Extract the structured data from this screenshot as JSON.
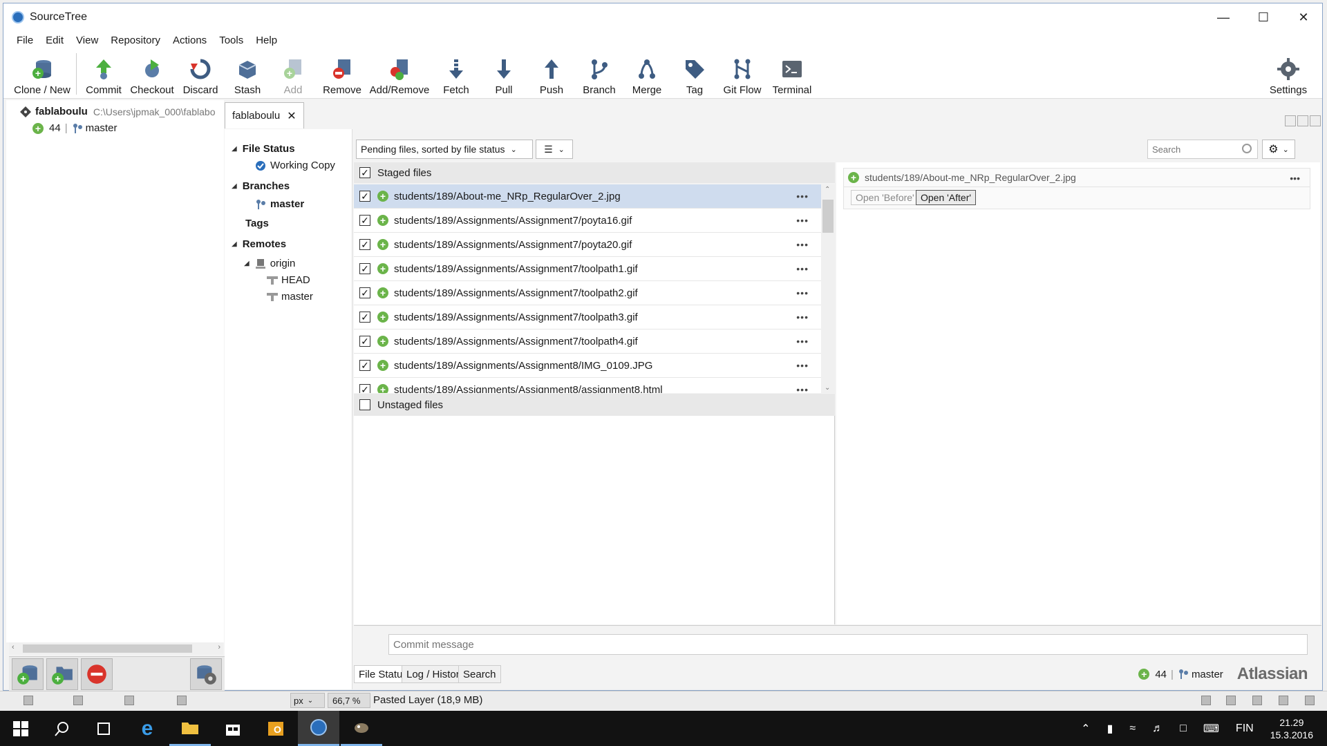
{
  "window": {
    "title": "SourceTree",
    "controls": [
      "minimize",
      "maximize",
      "close"
    ]
  },
  "menu": [
    "File",
    "Edit",
    "View",
    "Repository",
    "Actions",
    "Tools",
    "Help"
  ],
  "toolbar": {
    "clone": "Clone / New",
    "commit": "Commit",
    "checkout": "Checkout",
    "discard": "Discard",
    "stash": "Stash",
    "add": "Add",
    "remove": "Remove",
    "addremove": "Add/Remove",
    "fetch": "Fetch",
    "pull": "Pull",
    "push": "Push",
    "branch": "Branch",
    "merge": "Merge",
    "tag": "Tag",
    "gitflow": "Git Flow",
    "terminal": "Terminal",
    "settings": "Settings"
  },
  "repo": {
    "name": "fablaboulu",
    "path": "C:\\Users\\jpmak_000\\fablabo",
    "count": "44",
    "branch": "master"
  },
  "tab": {
    "label": "fablaboulu"
  },
  "tree": {
    "file_status": "File Status",
    "working_copy": "Working Copy",
    "branches": "Branches",
    "branch_master": "master",
    "tags": "Tags",
    "remotes": "Remotes",
    "origin": "origin",
    "head": "HEAD",
    "remote_master": "master"
  },
  "filter": {
    "sort": "Pending files, sorted by file status",
    "search_placeholder": "Search"
  },
  "staged": {
    "label": "Staged files",
    "files": [
      "students/189/About-me_NRp_RegularOver_2.jpg",
      "students/189/Assignments/Assignment7/poyta16.gif",
      "students/189/Assignments/Assignment7/poyta20.gif",
      "students/189/Assignments/Assignment7/toolpath1.gif",
      "students/189/Assignments/Assignment7/toolpath2.gif",
      "students/189/Assignments/Assignment7/toolpath3.gif",
      "students/189/Assignments/Assignment7/toolpath4.gif",
      "students/189/Assignments/Assignment8/IMG_0109.JPG",
      "students/189/Assignments/Assignment8/assignment8.html"
    ]
  },
  "unstaged": {
    "label": "Unstaged files"
  },
  "preview": {
    "file": "students/189/About-me_NRp_RegularOver_2.jpg",
    "open_before": "Open 'Before'",
    "open_after": "Open 'After'"
  },
  "commit": {
    "placeholder": "Commit message"
  },
  "bottom_tabs": [
    "File Status",
    "Log / History",
    "Search"
  ],
  "status": {
    "count": "44",
    "branch": "master",
    "brand": "Atlassian"
  },
  "gimp": {
    "unit": "px",
    "zoom": "66,7 %",
    "layer": "Pasted Layer (18,9 MB)"
  },
  "taskbar": {
    "lang": "FIN",
    "time": "21.29",
    "date": "15.3.2016"
  },
  "colors": {
    "accent": "#2a6ebb",
    "add_green": "#6bb44a",
    "remove_red": "#d9342b",
    "selection": "#cfdcee"
  }
}
